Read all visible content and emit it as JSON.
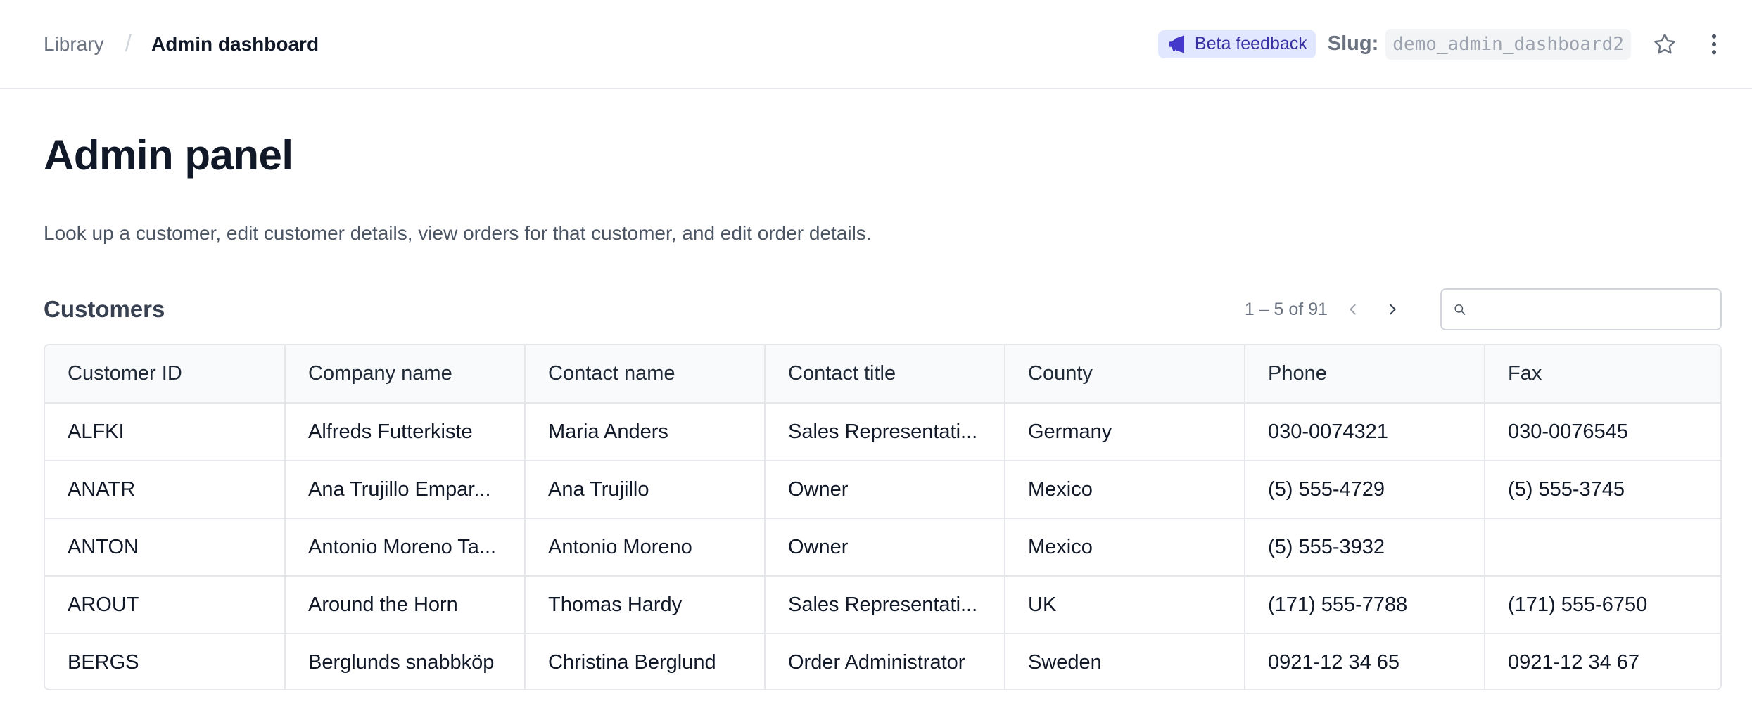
{
  "breadcrumb": {
    "root": "Library",
    "separator": "/",
    "current": "Admin dashboard"
  },
  "header": {
    "beta_feedback": "Beta feedback",
    "slug_label": "Slug:",
    "slug_value": "demo_admin_dashboard2"
  },
  "page": {
    "title": "Admin panel",
    "description": "Look up a customer, edit customer details, view orders for that customer, and edit order details."
  },
  "customers": {
    "title": "Customers",
    "pagination": "1 – 5 of 91",
    "search_placeholder": "",
    "columns": [
      "Customer ID",
      "Company name",
      "Contact name",
      "Contact title",
      "County",
      "Phone",
      "Fax"
    ],
    "rows": [
      [
        "ALFKI",
        "Alfreds Futterkiste",
        "Maria Anders",
        "Sales Representati...",
        "Germany",
        "030-0074321",
        "030-0076545"
      ],
      [
        "ANATR",
        "Ana Trujillo Empar...",
        "Ana Trujillo",
        "Owner",
        "Mexico",
        "(5) 555-4729",
        "(5) 555-3745"
      ],
      [
        "ANTON",
        "Antonio Moreno Ta...",
        "Antonio Moreno",
        "Owner",
        "Mexico",
        "(5) 555-3932",
        ""
      ],
      [
        "AROUT",
        "Around the Horn",
        "Thomas Hardy",
        "Sales Representati...",
        "UK",
        "(171) 555-7788",
        "(171) 555-6750"
      ],
      [
        "BERGS",
        "Berglunds snabbköp",
        "Christina Berglund",
        "Order Administrator",
        "Sweden",
        "0921-12 34 65",
        "0921-12 34 67"
      ]
    ]
  },
  "icons": {
    "beta": "megaphone-icon",
    "favorite": "star-icon",
    "menu": "kebab-menu-icon",
    "prev": "chevron-left-icon",
    "next": "chevron-right-icon",
    "search": "search-icon"
  },
  "colors": {
    "beta_bg": "#e0e7ff",
    "beta_text": "#3730a3",
    "border": "#e5e7eb",
    "header_bg": "#f9fafb"
  }
}
